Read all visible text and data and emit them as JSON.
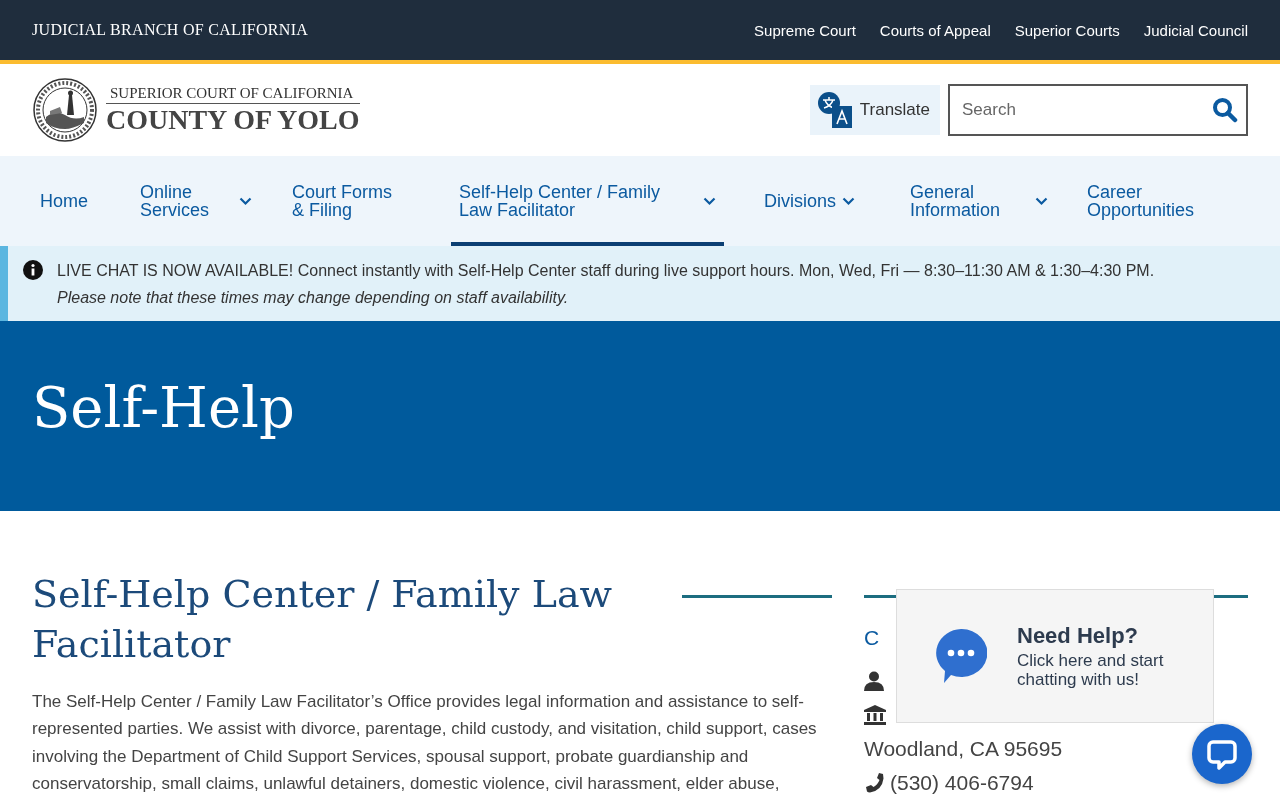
{
  "top_bar": {
    "title": "JUDICIAL BRANCH OF CALIFORNIA",
    "links": [
      "Supreme Court",
      "Courts of Appeal",
      "Superior Courts",
      "Judicial Council"
    ]
  },
  "header": {
    "logo": {
      "line_1": "SUPERIOR COURT OF CALIFORNIA",
      "line_2": "COUNTY OF YOLO"
    },
    "translate_button": "Translate",
    "search": {
      "placeholder": "Search"
    }
  },
  "nav": [
    {
      "label": "Home",
      "dropdown": false,
      "selected": false
    },
    {
      "label": "Online Services",
      "dropdown": true,
      "selected": false
    },
    {
      "label": "Court Forms & Filing",
      "dropdown": false,
      "selected": false
    },
    {
      "label": "Self-Help Center / Family Law Facilitator",
      "dropdown": true,
      "selected": true
    },
    {
      "label": "Divisions",
      "dropdown": true,
      "selected": false
    },
    {
      "label": "General Information",
      "dropdown": true,
      "selected": false
    },
    {
      "label": "Career Opportunities",
      "dropdown": false,
      "selected": false
    }
  ],
  "alert": {
    "text": "LIVE CHAT IS NOW AVAILABLE! Connect instantly with Self-Help Center staff during live support hours. Mon, Wed, Fri — 8:30–11:30 AM & 1:30–4:30 PM. *Please note that these times may change depending on staff availability.*"
  },
  "hero": {
    "title": "Self-Help"
  },
  "main": {
    "heading": "Self-Help Center / Family Law Facilitator",
    "paragraph": "The Self-Help Center / Family Law Facilitator’s Office provides legal information and assistance to self-represented parties. We assist with divorce, parentage, child custody, and visitation, child support, cases involving the Department of Child Support Services, spousal support, probate guardianship and conservatorship, small claims, unlawful detainers, domestic violence, civil harassment, elder abuse,"
  },
  "sidebar": {
    "heading": "C",
    "items": [
      {
        "kind": "person"
      },
      {
        "kind": "building"
      },
      {
        "kind": "plain",
        "text": "Woodland, CA 95695"
      },
      {
        "kind": "phone",
        "text": "(530) 406-6794"
      }
    ]
  },
  "chat_popup": {
    "title": "Need Help?",
    "text": "Click here and start chatting with us!"
  }
}
